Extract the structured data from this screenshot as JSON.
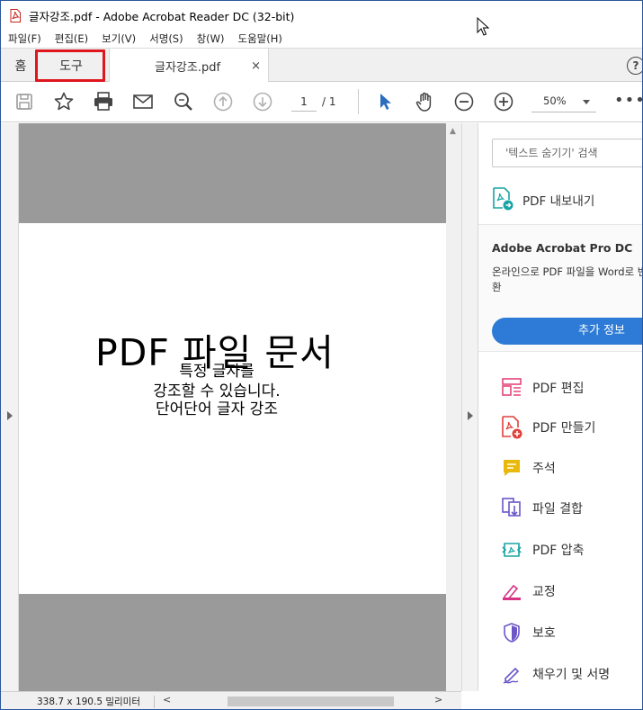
{
  "window": {
    "title": "글자강조.pdf - Adobe Acrobat Reader DC (32-bit)"
  },
  "menu": [
    "파일(F)",
    "편집(E)",
    "보기(V)",
    "서명(S)",
    "창(W)",
    "도움말(H)"
  ],
  "tabs": {
    "home": "홈",
    "tools": "도구",
    "document": "글자강조.pdf",
    "close": "×",
    "help": "?"
  },
  "toolbar": {
    "page_current": "1",
    "page_total": "/ 1",
    "zoom": "50%",
    "more": "•••"
  },
  "document": {
    "title": "PDF 파일 문서",
    "lines": [
      "특정 글자를",
      "강조할 수 있습니다.",
      "단어단어 글자 강조"
    ]
  },
  "status": {
    "dimensions": "338.7 x 190.5 밀리미터"
  },
  "right_panel": {
    "search_placeholder": "'텍스트 숨기기' 검색",
    "export_label": "PDF 내보내기",
    "promo_title": "Adobe Acrobat Pro DC",
    "promo_desc": "온라인으로 PDF 파일을 Word로 변환",
    "promo_button": "추가 정보",
    "tools": [
      {
        "label": "PDF 편집",
        "icon": "edit-pdf-icon",
        "color": "#e5467a"
      },
      {
        "label": "PDF 만들기",
        "icon": "create-pdf-icon",
        "color": "#e0403a"
      },
      {
        "label": "주석",
        "icon": "comment-icon",
        "color": "#e8b80a"
      },
      {
        "label": "파일 결합",
        "icon": "combine-files-icon",
        "color": "#6b56c8"
      },
      {
        "label": "PDF 압축",
        "icon": "compress-pdf-icon",
        "color": "#1aa3a3"
      },
      {
        "label": "교정",
        "icon": "redact-icon",
        "color": "#d63384"
      },
      {
        "label": "보호",
        "icon": "protect-icon",
        "color": "#6b56c8"
      },
      {
        "label": "채우기 및 서명",
        "icon": "fill-sign-icon",
        "color": "#6b56c8"
      }
    ]
  },
  "colors": {
    "highlight": "#e0161e",
    "accent": "#2d7bd6",
    "select_cursor": "#2a6ebd"
  }
}
